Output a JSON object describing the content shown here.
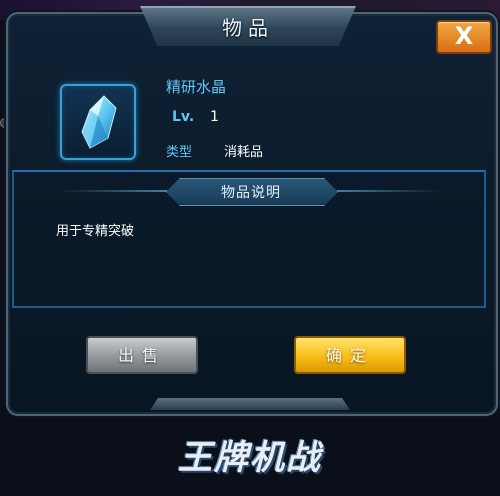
{
  "dialog": {
    "title": "物品",
    "close_label": "X"
  },
  "item": {
    "name": "精研水晶",
    "lv_label": "Lv.",
    "lv_value": "1",
    "type_label": "类型",
    "type_value": "消耗品",
    "icon": "crystal-icon"
  },
  "description": {
    "header": "物品说明",
    "text": "用于专精突破"
  },
  "buttons": {
    "sell_label": "出售",
    "confirm_label": "确定"
  },
  "logo": {
    "text": "王牌机战"
  },
  "colors": {
    "accent": "#5fc7f5",
    "confirm": "#f6b914",
    "close": "#e0821f"
  }
}
